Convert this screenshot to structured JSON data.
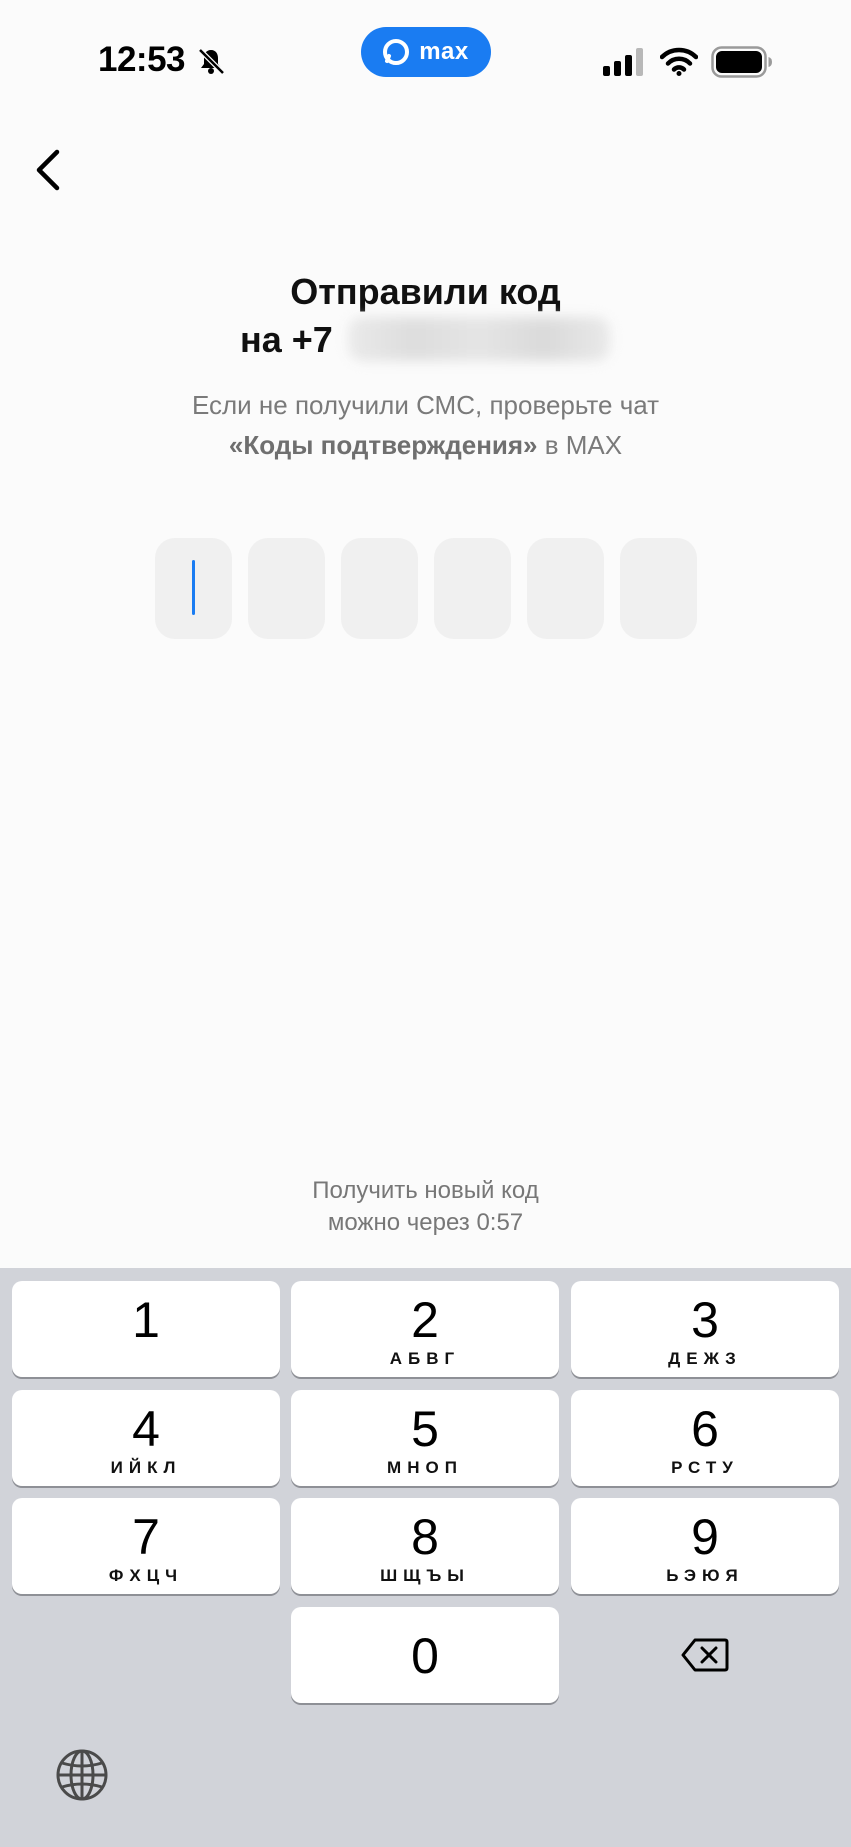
{
  "status_bar": {
    "time": "12:53",
    "app_badge": "max",
    "icons": [
      "mute-bell-icon",
      "signal-icon",
      "wifi-icon",
      "battery-icon"
    ]
  },
  "navigation": {
    "back_icon": "chevron-left-icon"
  },
  "heading": {
    "line1": "Отправили код",
    "line2": "на +7"
  },
  "subtitle": {
    "line1": "Если не получили СМС, проверьте чат",
    "quoted_chat": "«Коды подтверждения»",
    "line2_suffix": " в MAX"
  },
  "code_input": {
    "length": 6,
    "values": [
      "",
      "",
      "",
      "",
      "",
      ""
    ],
    "active_index": 0
  },
  "resend": {
    "line1": "Получить новый код",
    "line2": "можно через 0:57"
  },
  "keypad": {
    "keys": [
      {
        "digit": "1",
        "letters": ""
      },
      {
        "digit": "2",
        "letters": "АБВГ"
      },
      {
        "digit": "3",
        "letters": "ДЕЖЗ"
      },
      {
        "digit": "4",
        "letters": "ИЙКЛ"
      },
      {
        "digit": "5",
        "letters": "МНОП"
      },
      {
        "digit": "6",
        "letters": "РСТУ"
      },
      {
        "digit": "7",
        "letters": "ФХЦЧ"
      },
      {
        "digit": "8",
        "letters": "ШЩЪЫ"
      },
      {
        "digit": "9",
        "letters": "ЬЭЮЯ"
      },
      {
        "digit": "0",
        "letters": ""
      }
    ],
    "backspace_icon": "backspace-icon",
    "globe_icon": "globe-icon"
  },
  "colors": {
    "accent": "#1a7cf2",
    "background": "#fbfbfb",
    "keypad_background": "#d1d3d9",
    "code_box": "#f0f0f0"
  }
}
